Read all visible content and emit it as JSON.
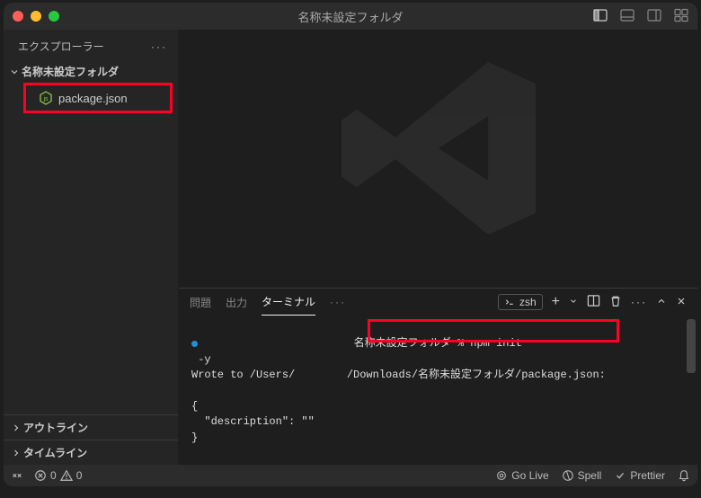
{
  "window": {
    "title": "名称未設定フォルダ"
  },
  "sidebar": {
    "explorer_label": "エクスプローラー",
    "folder_name": "名称未設定フォルダ",
    "files": [
      {
        "name": "package.json",
        "icon": "nodejs"
      }
    ],
    "outline_label": "アウトライン",
    "timeline_label": "タイムライン"
  },
  "panel": {
    "tabs": {
      "problems": "問題",
      "output": "出力",
      "terminal": "ターミナル"
    },
    "shell_label": "zsh"
  },
  "terminal": {
    "prompt_folder": "名称未設定フォルダ",
    "prompt_separator": " % ",
    "command": "npm init",
    "line2": " -y",
    "line3_prefix": "Wrote to /Users/",
    "line3_suffix": "/Downloads/名称未設定フォルダ/package.json:",
    "line4": "",
    "line5": "{",
    "line6": "  \"description\": \"\"",
    "line7": "}"
  },
  "statusbar": {
    "errors": "0",
    "warnings": "0",
    "golive": "Go Live",
    "spell": "Spell",
    "prettier": "Prettier"
  }
}
